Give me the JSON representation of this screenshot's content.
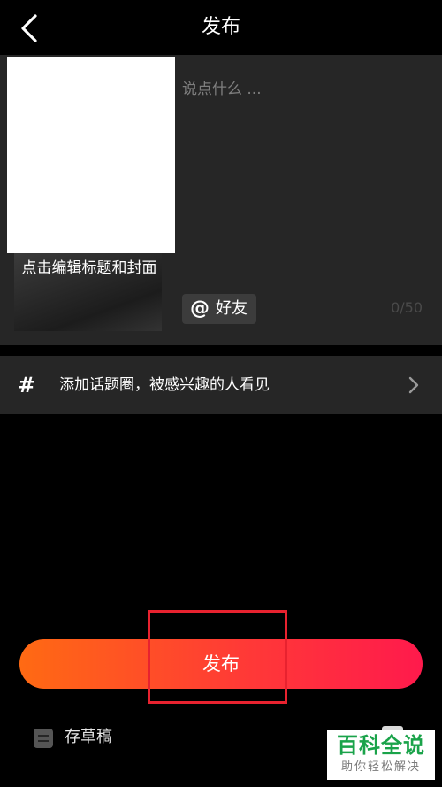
{
  "header": {
    "title": "发布",
    "back_icon": "chevron-left-icon"
  },
  "compose": {
    "cover_label": "点击编辑标题和封面",
    "caption_placeholder": "说点什么 ...",
    "mention_symbol": "@",
    "mention_label": "好友",
    "char_count": "0/50"
  },
  "topic": {
    "icon": "hash-icon",
    "label": "添加话题圈，被感兴趣的人看见",
    "chevron_icon": "chevron-right-icon"
  },
  "actions": {
    "publish_label": "发布",
    "draft_label": "存草稿",
    "draft_icon": "draft-icon"
  },
  "watermark": {
    "title": "百科全说",
    "subtitle": "助你轻松解决"
  },
  "colors": {
    "background": "#000000",
    "panel": "#262626",
    "publish_gradient_start": "#ff6a13",
    "publish_gradient_end": "#ff1a4c",
    "highlight": "#e8222f",
    "watermark_green": "#1aa34a"
  }
}
